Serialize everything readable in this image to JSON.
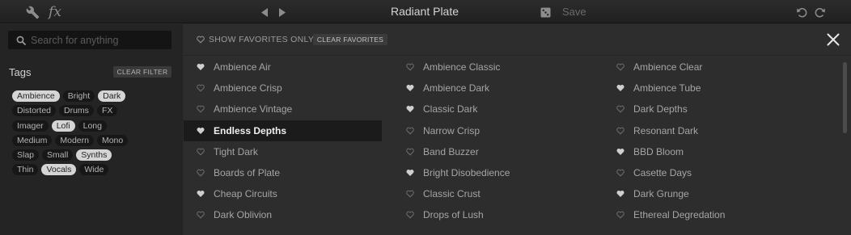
{
  "toolbar": {
    "preset_title": "Radiant Plate",
    "save_label": "Save",
    "icons": [
      "wrench-icon",
      "fx-icon",
      "prev-arrow-icon",
      "next-arrow-icon",
      "dice-icon",
      "undo-icon",
      "redo-icon"
    ],
    "fx_label": "fx"
  },
  "sidebar": {
    "search_placeholder": "Search for anything",
    "tags_title": "Tags",
    "clear_filter_label": "CLEAR FILTER",
    "tag_rows": [
      [
        {
          "label": "Ambience",
          "selected": true
        },
        {
          "label": "Bright",
          "selected": false
        },
        {
          "label": "Dark",
          "selected": true
        }
      ],
      [
        {
          "label": "Distorted",
          "selected": false
        },
        {
          "label": "Drums",
          "selected": false
        },
        {
          "label": "FX",
          "selected": false
        }
      ],
      [
        {
          "label": "Imager",
          "selected": false
        },
        {
          "label": "Lofi",
          "selected": true
        },
        {
          "label": "Long",
          "selected": false
        }
      ],
      [
        {
          "label": "Medium",
          "selected": false
        },
        {
          "label": "Modern",
          "selected": false
        },
        {
          "label": "Mono",
          "selected": false
        }
      ],
      [
        {
          "label": "Slap",
          "selected": false
        },
        {
          "label": "Small",
          "selected": false
        },
        {
          "label": "Synths",
          "selected": true
        }
      ],
      [
        {
          "label": "Thin",
          "selected": false
        },
        {
          "label": "Vocals",
          "selected": true
        },
        {
          "label": "Wide",
          "selected": false
        }
      ]
    ]
  },
  "browser": {
    "show_favorites_label": "SHOW FAVORITES ONLY",
    "clear_favorites_label": "CLEAR FAVORITES",
    "highlighted_preset": "Endless Depths",
    "columns": [
      [
        {
          "name": "Ambience Air",
          "favorite": true
        },
        {
          "name": "Ambience Crisp",
          "favorite": false
        },
        {
          "name": "Ambience Vintage",
          "favorite": false
        },
        {
          "name": "Endless Depths",
          "favorite": true
        },
        {
          "name": "Tight Dark",
          "favorite": false
        },
        {
          "name": "Boards of Plate",
          "favorite": false
        },
        {
          "name": "Cheap Circuits",
          "favorite": true
        },
        {
          "name": "Dark Oblivion",
          "favorite": false
        }
      ],
      [
        {
          "name": "Ambience Classic",
          "favorite": false
        },
        {
          "name": "Ambience Dark",
          "favorite": true
        },
        {
          "name": "Classic Dark",
          "favorite": true
        },
        {
          "name": "Narrow Crisp",
          "favorite": false
        },
        {
          "name": "Band Buzzer",
          "favorite": false
        },
        {
          "name": "Bright Disobedience",
          "favorite": true
        },
        {
          "name": "Classic Crust",
          "favorite": false
        },
        {
          "name": "Drops of Lush",
          "favorite": false
        }
      ],
      [
        {
          "name": "Ambience Clear",
          "favorite": false
        },
        {
          "name": "Ambience Tube",
          "favorite": true
        },
        {
          "name": "Dark Depths",
          "favorite": false
        },
        {
          "name": "Resonant Dark",
          "favorite": false
        },
        {
          "name": "BBD Bloom",
          "favorite": true
        },
        {
          "name": "Casette Days",
          "favorite": false
        },
        {
          "name": "Dark Grunge",
          "favorite": true
        },
        {
          "name": "Ethereal Degredation",
          "favorite": false
        }
      ]
    ]
  },
  "colors": {
    "heart_filled": "#cfcfcf",
    "heart_outline": "#6a6a6a",
    "chip_selected": "#d5d5d5",
    "chip_unselected": "#171718"
  }
}
